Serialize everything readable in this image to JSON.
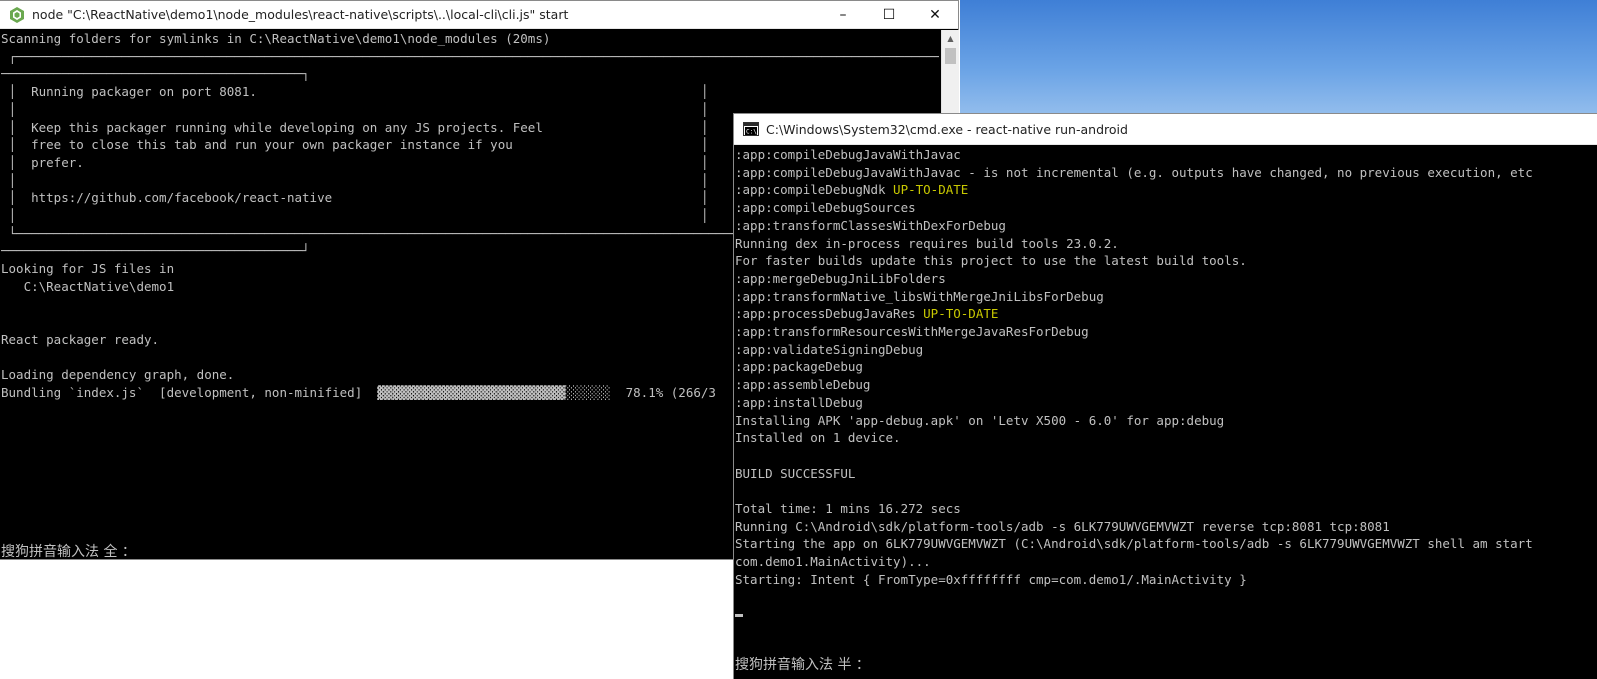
{
  "node_window": {
    "title": "node  \"C:\\ReactNative\\demo1\\node_modules\\react-native\\scripts\\..\\local-cli\\cli.js\" start",
    "icon": "nodejs-icon",
    "minimize": "–",
    "maximize": "☐",
    "close": "✕",
    "lines": [
      "Scanning folders for symlinks in C:\\ReactNative\\demo1\\node_modules (20ms)",
      " ┌─────────────────────────────────────────────────────────────────────────────────────────────────────────────────────────────────",
      "────────────────────────────────────────┐",
      " │  Running packager on port 8081.                                                           │",
      " │                                                                                           │",
      " │  Keep this packager running while developing on any JS projects. Feel                     │",
      " │  free to close this tab and run your own packager instance if you                         │",
      " │  prefer.                                                                                  │",
      " │                                                                                           │",
      " │  https://github.com/facebook/react-native                                                 │",
      " │                                                                                           │",
      " └─────────────────────────────────────────────────────────────────────────────────────────────────────────────────────────────────",
      "────────────────────────────────────────┘",
      "Looking for JS files in",
      "   C:\\ReactNative\\demo1",
      "",
      "",
      "React packager ready.",
      "",
      "Loading dependency graph, done.",
      "Bundling `index.js`  [development, non-minified]  ▓▓▓▓▓▓▓▓▓▓▓▓▓▓▓▓▓▓▓▓▓▓▓▓▓░░░░░░  78.1% (266/3"
    ],
    "ime_status": "搜狗拼音输入法 全 ："
  },
  "cmd_window": {
    "title": "C:\\Windows\\System32\\cmd.exe - react-native  run-android",
    "icon": "cmd-icon",
    "lines": [
      [
        ":app:compileDebugJavaWithJavac",
        ""
      ],
      [
        ":app:compileDebugJavaWithJavac - is not incremental (e.g. outputs have changed, no previous execution, etc",
        ""
      ],
      [
        ":app:compileDebugNdk ",
        "UP-TO-DATE"
      ],
      [
        ":app:compileDebugSources",
        ""
      ],
      [
        ":app:transformClassesWithDexForDebug",
        ""
      ],
      [
        "Running dex in-process requires build tools 23.0.2.",
        ""
      ],
      [
        "For faster builds update this project to use the latest build tools.",
        ""
      ],
      [
        ":app:mergeDebugJniLibFolders",
        ""
      ],
      [
        ":app:transformNative_libsWithMergeJniLibsForDebug",
        ""
      ],
      [
        ":app:processDebugJavaRes ",
        "UP-TO-DATE"
      ],
      [
        ":app:transformResourcesWithMergeJavaResForDebug",
        ""
      ],
      [
        ":app:validateSigningDebug",
        ""
      ],
      [
        ":app:packageDebug",
        ""
      ],
      [
        ":app:assembleDebug",
        ""
      ],
      [
        ":app:installDebug",
        ""
      ],
      [
        "Installing APK 'app-debug.apk' on 'Letv X500 - 6.0' for app:debug",
        ""
      ],
      [
        "Installed on 1 device.",
        ""
      ],
      [
        "",
        ""
      ],
      [
        "BUILD SUCCESSFUL",
        ""
      ],
      [
        "",
        ""
      ],
      [
        "Total time: 1 mins 16.272 secs",
        ""
      ],
      [
        "Running C:\\Android\\sdk/platform-tools/adb -s 6LK779UWVGEMVWZT reverse tcp:8081 tcp:8081",
        ""
      ],
      [
        "Starting the app on 6LK779UWVGEMVWZT (C:\\Android\\sdk/platform-tools/adb -s 6LK779UWVGEMVWZT shell am start",
        ""
      ],
      [
        "com.demo1.MainActivity)...",
        ""
      ],
      [
        "Starting: Intent { FromType=0xffffffff cmp=com.demo1/.MainActivity }",
        ""
      ]
    ],
    "ime_status": "搜狗拼音输入法 半 ："
  },
  "colors": {
    "console_bg": "#000000",
    "console_text": "#c0c0c0",
    "status_yellow": "#c8c800"
  }
}
